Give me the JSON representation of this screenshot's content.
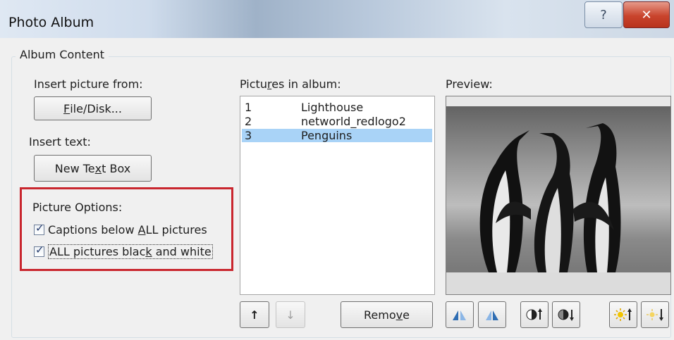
{
  "window": {
    "title": "Photo Album",
    "help_glyph": "?",
    "close_glyph": "✕"
  },
  "album_content": {
    "legend": "Album Content",
    "insert_picture_label": "Insert picture from:",
    "file_disk_button": {
      "pre": "",
      "ul": "F",
      "post": "ile/Disk..."
    },
    "insert_text_label": "Insert text:",
    "new_text_box_button": {
      "pre": "New Te",
      "ul": "x",
      "post": "t Box"
    },
    "picture_options": {
      "label": "Picture Options:",
      "captions": {
        "pre": "Captions below ",
        "ul": "A",
        "post": "LL pictures",
        "checked": true
      },
      "black_white": {
        "pre": "ALL pictures blac",
        "ul": "k",
        "post": " and white",
        "checked": true
      }
    }
  },
  "pictures": {
    "label_pre": "Pictu",
    "label_ul": "r",
    "label_post": "es in album:",
    "items": [
      {
        "num": "1",
        "name": "Lighthouse",
        "selected": false
      },
      {
        "num": "2",
        "name": "networld_redlogo2",
        "selected": false
      },
      {
        "num": "3",
        "name": "Penguins",
        "selected": true
      }
    ],
    "move_up_icon": "move-up-icon",
    "move_down_icon": "move-down-icon",
    "remove_button": {
      "pre": "Remo",
      "ul": "v",
      "post": "e"
    }
  },
  "preview": {
    "label": "Preview:",
    "tools": [
      "rotate-left-icon",
      "rotate-right-icon",
      "contrast-up-icon",
      "contrast-down-icon",
      "brightness-up-icon",
      "brightness-down-icon"
    ]
  }
}
